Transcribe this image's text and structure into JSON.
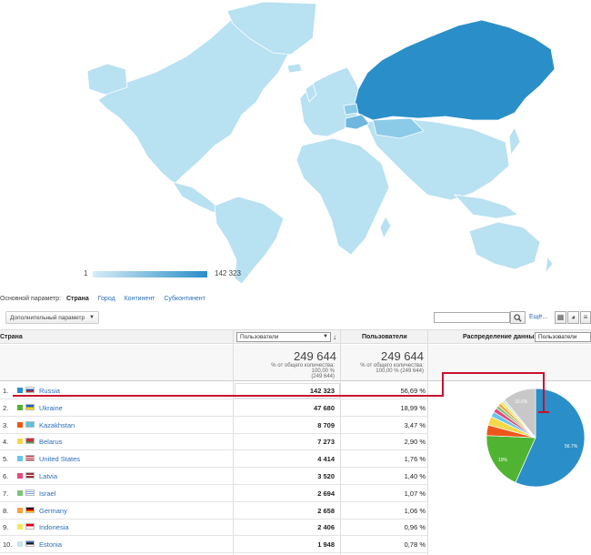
{
  "legend": {
    "min": "1",
    "max": "142 323"
  },
  "dimensions": {
    "label": "Основной параметр:",
    "active": "Страна",
    "links": [
      "Город",
      "Континент",
      "Субконтинент"
    ]
  },
  "toolbar": {
    "secondary_dimension": "Дополнительный параметр",
    "search_placeholder": "",
    "more_link": "Ещё..."
  },
  "table": {
    "headers": {
      "country": "Страна",
      "metric_select": "Пользователи",
      "users": "Пользователи",
      "distribution": "Распределение данных:",
      "distribution_select": "Пользователи"
    },
    "totals": {
      "value1": "249 644",
      "sub1_line1": "% от общего количества:",
      "sub1_line2": "100,00 %",
      "sub1_line3": "(249 644)",
      "value2": "249 644",
      "sub2_line1": "% от общего количества:",
      "sub2_line2": "100,00 % (249 644)"
    },
    "rows": [
      {
        "num": "1.",
        "country": "Russia",
        "users": "142 323",
        "pct": "56,69 %",
        "color": "#2a8ec8"
      },
      {
        "num": "2.",
        "country": "Ukraine",
        "users": "47 680",
        "pct": "18,99 %",
        "color": "#50b432"
      },
      {
        "num": "3.",
        "country": "Kazakhstan",
        "users": "8 709",
        "pct": "3,47 %",
        "color": "#ed561b"
      },
      {
        "num": "4.",
        "country": "Belarus",
        "users": "7 273",
        "pct": "2,90 %",
        "color": "#f4d84a"
      },
      {
        "num": "5.",
        "country": "United States",
        "users": "4 414",
        "pct": "1,76 %",
        "color": "#6ac6e8"
      },
      {
        "num": "6.",
        "country": "Latvia",
        "users": "3 520",
        "pct": "1,40 %",
        "color": "#e64a7a"
      },
      {
        "num": "7.",
        "country": "Israel",
        "users": "2 694",
        "pct": "1,07 %",
        "color": "#7cc576"
      },
      {
        "num": "8.",
        "country": "Germany",
        "users": "2 658",
        "pct": "1,06 %",
        "color": "#f9a03f"
      },
      {
        "num": "9.",
        "country": "Indonesia",
        "users": "2 406",
        "pct": "0,96 %",
        "color": "#f2ea5e"
      },
      {
        "num": "10.",
        "country": "Estonia",
        "users": "1 948",
        "pct": "0,78 %",
        "color": "#c7e4f2"
      }
    ]
  },
  "pie": {
    "labels": {
      "russia": "56.7%",
      "ukraine": "19%",
      "other": "10.6%"
    },
    "slices": [
      56.69,
      18.99,
      3.47,
      2.9,
      1.76,
      1.4,
      1.07,
      1.06,
      0.96,
      0.78,
      10.92
    ],
    "colors": [
      "#2a8ec8",
      "#50b432",
      "#ed561b",
      "#f4d84a",
      "#6ac6e8",
      "#e64a7a",
      "#7cc576",
      "#f9a03f",
      "#f2ea5e",
      "#c7e4f2",
      "#c8c8c8"
    ]
  },
  "colors": {
    "map_light": "#b8e1f2",
    "map_dark": "#2a8ec8",
    "highlight": "#c8102e"
  }
}
